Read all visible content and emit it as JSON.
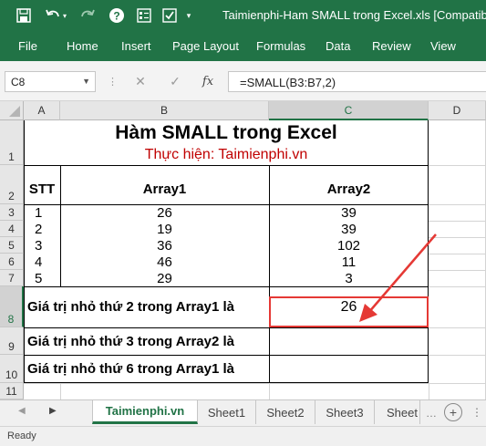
{
  "app": {
    "title": "Taimienphi-Ham SMALL trong Excel.xls  [Compatibility",
    "accent": "#217346"
  },
  "quick_access": {
    "icons": [
      "save-icon",
      "undo-icon",
      "redo-icon",
      "help-icon",
      "form-icon",
      "customize-icon"
    ]
  },
  "ribbon": {
    "tabs": [
      "File",
      "Home",
      "Insert",
      "Page Layout",
      "Formulas",
      "Data",
      "Review",
      "View"
    ]
  },
  "formula_bar": {
    "name_box": "C8",
    "formula": "=SMALL(B3:B7,2)",
    "fx_label": "fx"
  },
  "columns": [
    "A",
    "B",
    "C",
    "D"
  ],
  "rows": [
    "1",
    "2",
    "3",
    "4",
    "5",
    "6",
    "7",
    "8",
    "9",
    "10",
    "11"
  ],
  "sheet": {
    "title": "Hàm SMALL trong Excel",
    "subtitle": "Thực hiện: Taimienphi.vn",
    "headers": {
      "stt": "STT",
      "array1": "Array1",
      "array2": "Array2"
    },
    "data_rows": [
      {
        "stt": "1",
        "array1": "26",
        "array2": "39"
      },
      {
        "stt": "2",
        "array1": "19",
        "array2": "39"
      },
      {
        "stt": "3",
        "array1": "36",
        "array2": "102"
      },
      {
        "stt": "4",
        "array1": "46",
        "array2": "11"
      },
      {
        "stt": "5",
        "array1": "29",
        "array2": "3"
      }
    ],
    "questions": [
      {
        "label": "Giá trị nhỏ thứ 2 trong Array1 là",
        "result": "26"
      },
      {
        "label": "Giá trị nhỏ thứ 3 trong Array2 là",
        "result": ""
      },
      {
        "label": "Giá trị nhỏ thứ 6 trong Array1 là",
        "result": ""
      }
    ],
    "subtitle_color": "#c00000",
    "highlight_color": "#e53935"
  },
  "sheet_tabs": {
    "active": "Taimienphi.vn",
    "others": [
      "Sheet1",
      "Sheet2",
      "Sheet3",
      "Sheet"
    ]
  },
  "status": {
    "text": "Ready"
  }
}
